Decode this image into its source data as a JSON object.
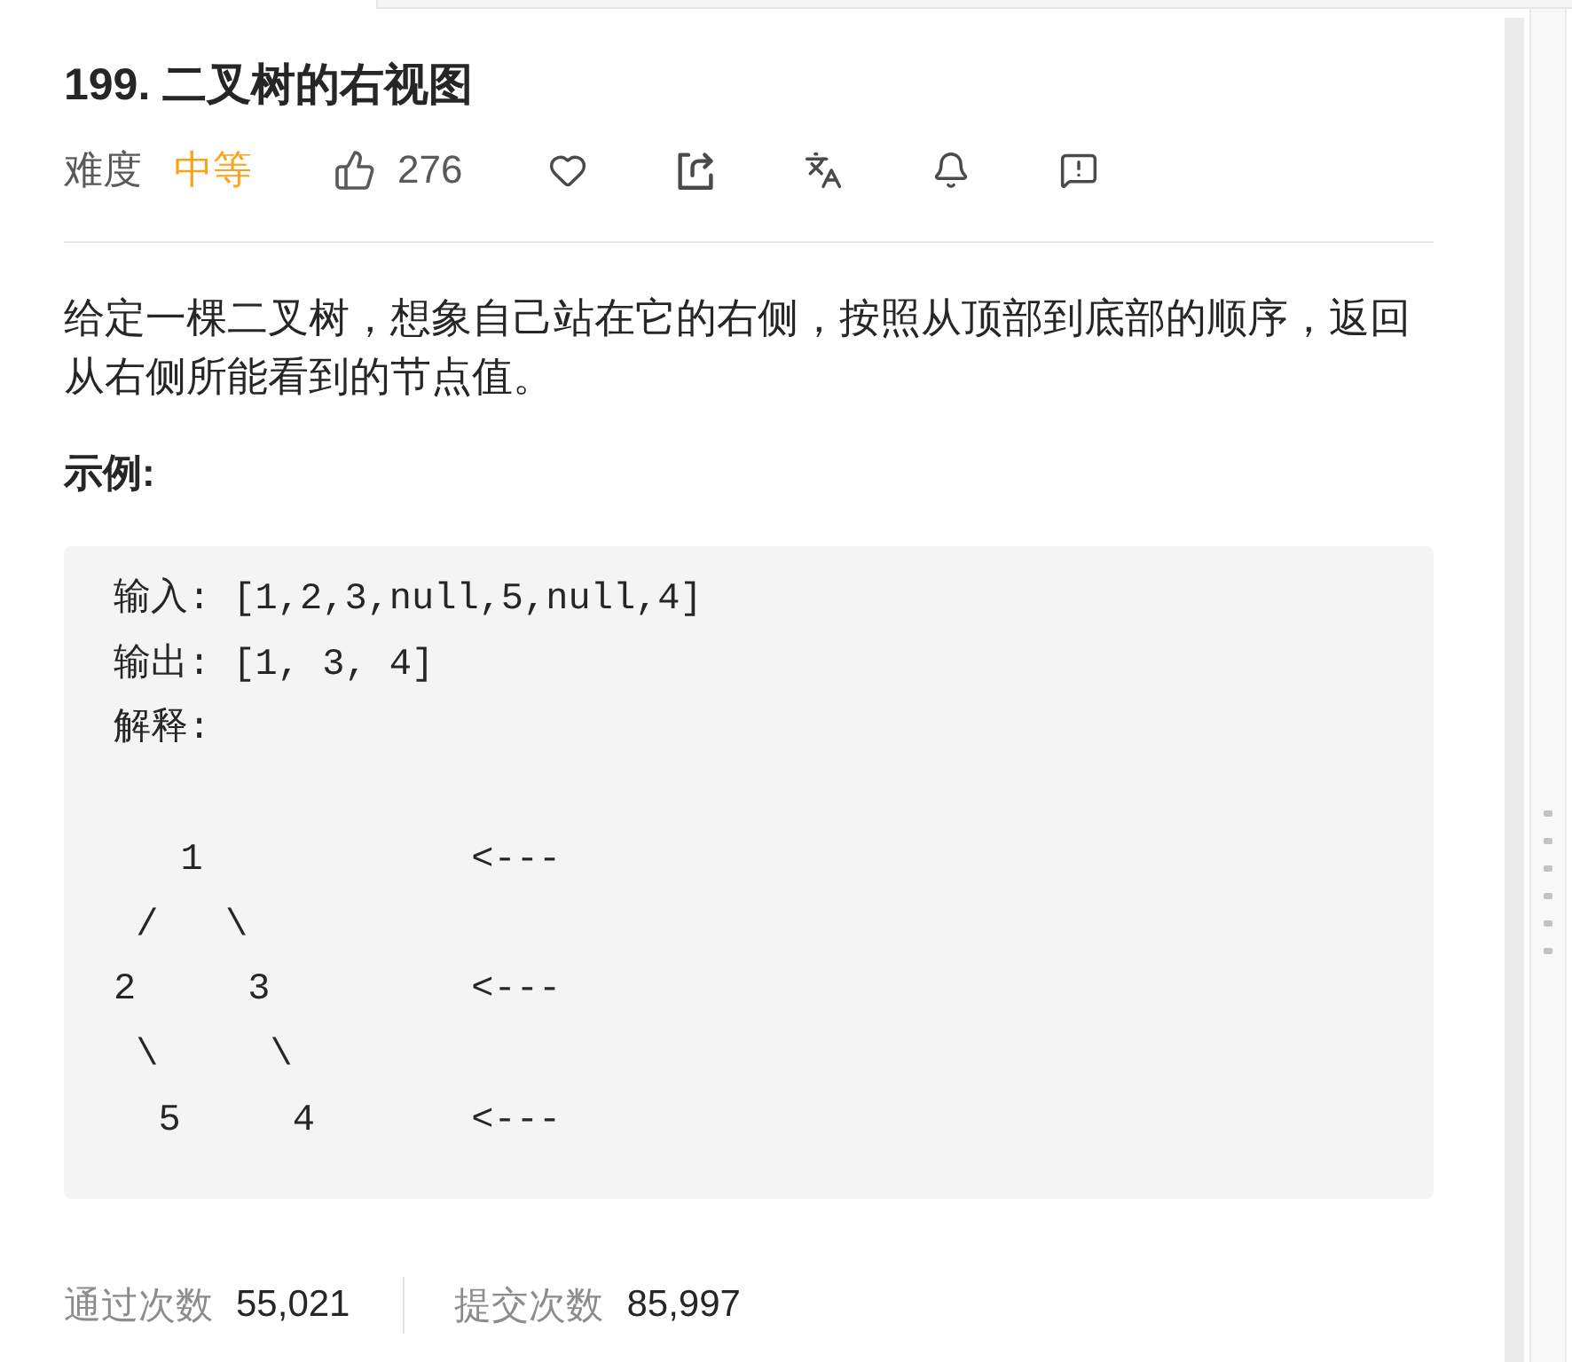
{
  "problem": {
    "title": "199. 二叉树的右视图",
    "difficulty_label": "难度",
    "difficulty": {
      "kind": "medium",
      "text": "中等"
    },
    "likes": "276"
  },
  "description": "给定一棵二叉树，想象自己站在它的右侧，按照从顶部到底部的顺序，返回从右侧所能看到的节点值。",
  "example": {
    "heading": "示例:",
    "input": "输入: [1,2,3,null,5,null,4]",
    "output": "输出: [1, 3, 4]",
    "explanation": "解释:",
    "diagram": [
      "   1            <---",
      " /   \\",
      "2     3         <---",
      " \\     \\",
      "  5     4       <---"
    ]
  },
  "stats": [
    {
      "label": "通过次数",
      "value": "55,021"
    },
    {
      "label": "提交次数",
      "value": "85,997"
    }
  ]
}
